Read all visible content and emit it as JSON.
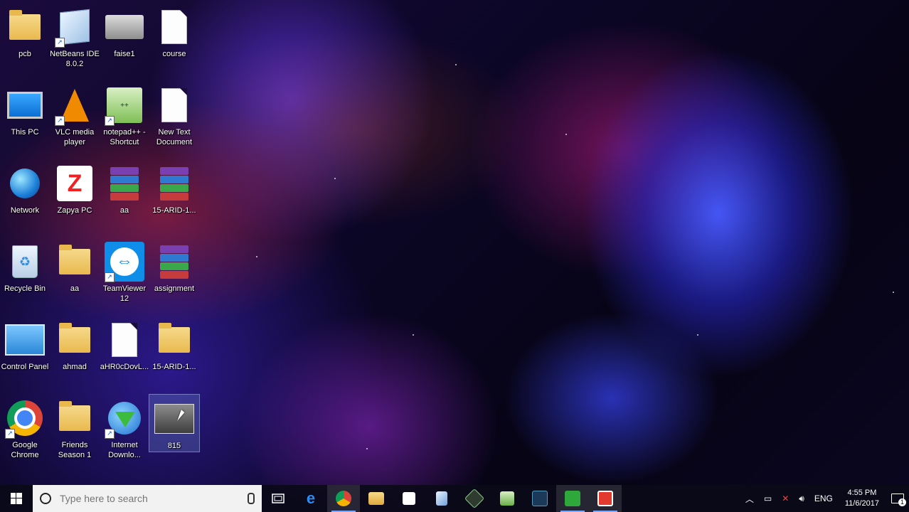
{
  "desktop": {
    "icons": [
      {
        "label": "pcb",
        "icon": "folder-person-icon"
      },
      {
        "label": "NetBeans IDE 8.0.2",
        "icon": "netbeans-icon"
      },
      {
        "label": "faise1",
        "icon": "printer-image-icon"
      },
      {
        "label": "course",
        "icon": "text-document-icon"
      },
      {
        "label": "This PC",
        "icon": "computer-icon"
      },
      {
        "label": "VLC media player",
        "icon": "vlc-cone-icon"
      },
      {
        "label": "notepad++ - Shortcut",
        "icon": "notepadpp-icon"
      },
      {
        "label": "New Text Document",
        "icon": "text-document-icon"
      },
      {
        "label": "Network",
        "icon": "network-globe-icon"
      },
      {
        "label": "Zapya PC",
        "icon": "zapya-icon"
      },
      {
        "label": "aa",
        "icon": "winrar-archive-icon"
      },
      {
        "label": "15-ARID-1...",
        "icon": "winrar-archive-icon"
      },
      {
        "label": "Recycle Bin",
        "icon": "recycle-bin-icon"
      },
      {
        "label": "aa",
        "icon": "folder-icon"
      },
      {
        "label": "TeamViewer 12",
        "icon": "teamviewer-icon"
      },
      {
        "label": "assignment",
        "icon": "winrar-archive-icon"
      },
      {
        "label": "Control Panel",
        "icon": "control-panel-icon"
      },
      {
        "label": "ahmad",
        "icon": "folder-icon"
      },
      {
        "label": "aHR0cDovL...",
        "icon": "blank-file-icon"
      },
      {
        "label": "15-ARID-1...",
        "icon": "folder-docs-icon"
      },
      {
        "label": "Google Chrome",
        "icon": "chrome-icon"
      },
      {
        "label": "Friends Season 1",
        "icon": "folder-video-icon"
      },
      {
        "label": "Internet Downlo...",
        "icon": "idm-icon"
      },
      {
        "label": "815",
        "icon": "video-thumbnail-icon"
      }
    ]
  },
  "taskbar": {
    "search_placeholder": "Type here to search",
    "apps": [
      {
        "name": "task-view-icon"
      },
      {
        "name": "edge-icon"
      },
      {
        "name": "chrome-icon"
      },
      {
        "name": "file-explorer-icon"
      },
      {
        "name": "store-icon"
      },
      {
        "name": "netbeans-icon"
      },
      {
        "name": "app-icon"
      },
      {
        "name": "notepadpp-icon"
      },
      {
        "name": "app-icon"
      },
      {
        "name": "camtasia-icon"
      },
      {
        "name": "recorder-icon"
      }
    ],
    "tray": {
      "language": "ENG",
      "time": "4:55 PM",
      "date": "11/6/2017",
      "notification_count": "1"
    }
  },
  "colors": {
    "taskbar_bg": "#0a0a18",
    "accent": "#7aa8ff"
  }
}
